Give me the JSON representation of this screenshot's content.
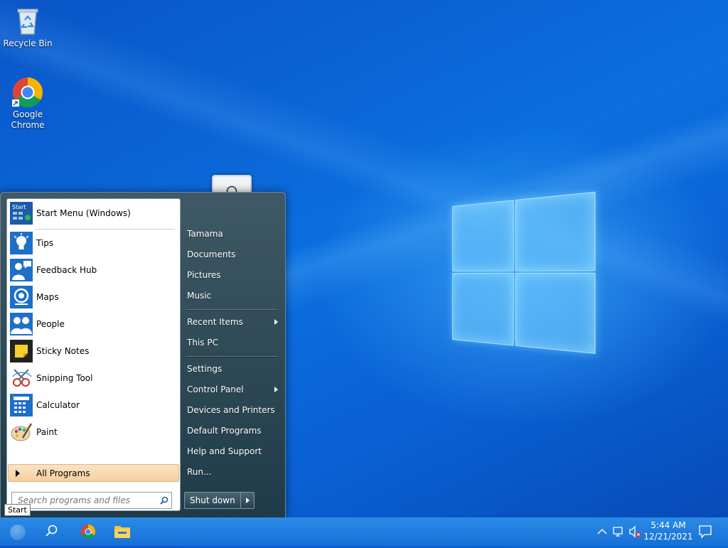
{
  "desktop": {
    "icons": [
      {
        "label": "Recycle Bin",
        "icon": "recycle-bin-icon"
      },
      {
        "label": "Google\nChrome",
        "icon": "chrome-icon"
      }
    ]
  },
  "start_menu": {
    "pinned": [
      {
        "label": "Start Menu (Windows)",
        "icon": "start-menu-app-icon"
      }
    ],
    "programs": [
      {
        "label": "Tips",
        "icon": "lightbulb-icon"
      },
      {
        "label": "Feedback Hub",
        "icon": "feedback-person-icon"
      },
      {
        "label": "Maps",
        "icon": "maps-icon"
      },
      {
        "label": "People",
        "icon": "people-icon"
      },
      {
        "label": "Sticky Notes",
        "icon": "sticky-note-icon"
      },
      {
        "label": "Snipping Tool",
        "icon": "scissors-icon"
      },
      {
        "label": "Calculator",
        "icon": "calculator-icon"
      },
      {
        "label": "Paint",
        "icon": "paint-palette-icon"
      }
    ],
    "all_programs": "All Programs",
    "search_placeholder": "Search programs and files",
    "right_items": [
      {
        "label": "Tamama"
      },
      {
        "label": "Documents"
      },
      {
        "label": "Pictures"
      },
      {
        "label": "Music"
      },
      {
        "label": "Recent Items",
        "submenu": true
      },
      {
        "label": "This PC"
      },
      {
        "label": "Settings"
      },
      {
        "label": "Control Panel",
        "submenu": true
      },
      {
        "label": "Devices and Printers"
      },
      {
        "label": "Default Programs"
      },
      {
        "label": "Help and Support"
      },
      {
        "label": "Run..."
      }
    ],
    "shutdown": "Shut down"
  },
  "tooltip": "Start",
  "taskbar": {
    "time": "5:44 AM",
    "date": "12/21/2021"
  },
  "colors": {
    "taskbar": "#1670d6",
    "menu_dark": "#1f3a48",
    "all_programs_highlight": "#f6cf9f"
  }
}
